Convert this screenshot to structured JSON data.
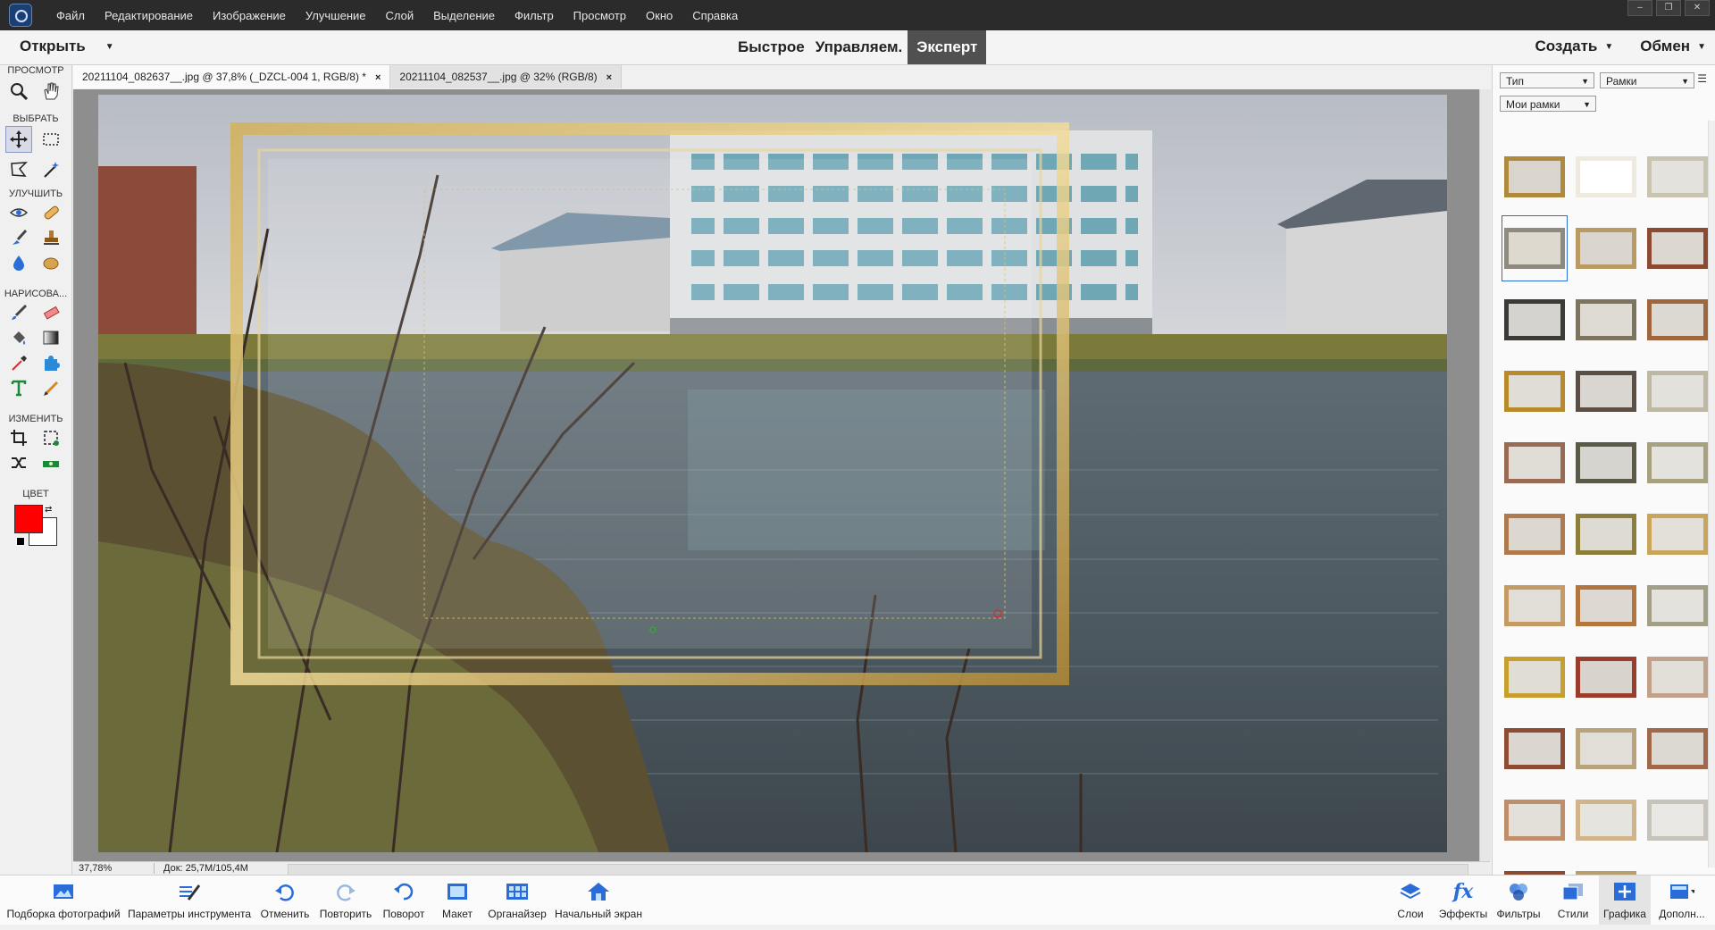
{
  "menubar": {
    "items": [
      "Файл",
      "Редактирование",
      "Изображение",
      "Улучшение",
      "Слой",
      "Выделение",
      "Фильтр",
      "Просмотр",
      "Окно",
      "Справка"
    ]
  },
  "modebar": {
    "open_label": "Открыть",
    "modes": [
      "Быстрое",
      "Управляем.",
      "Эксперт"
    ],
    "active_mode": "Эксперт",
    "create_label": "Создать",
    "share_label": "Обмен"
  },
  "toolbox": {
    "sections": [
      "ПРОСМОТР",
      "ВЫБРАТЬ",
      "УЛУЧШИТЬ",
      "НАРИСОВА...",
      "ИЗМЕНИТЬ",
      "ЦВЕТ"
    ],
    "foreground_color": "#ff0000",
    "background_color": "#ffffff"
  },
  "doc_tabs": [
    {
      "title": "20211104_082637__.jpg @ 37,8% (_DZCL-004 1, RGB/8) *",
      "close": "×"
    },
    {
      "title": "20211104_082537__.jpg @ 32% (RGB/8)",
      "close": "×"
    }
  ],
  "status": {
    "zoom": "37,78%",
    "doc": "Док: 25,7M/105,4M"
  },
  "panel": {
    "type_dropdown": "Тип",
    "category_dropdown": "Рамки",
    "set_dropdown": "Мои рамки",
    "frames": [
      {
        "outer": "#b08a3c",
        "inner": "#d9d5cc"
      },
      {
        "outer": "#efeae0",
        "inner": "#ffffff"
      },
      {
        "outer": "#c9c3b1",
        "inner": "#e4e2dc"
      },
      {
        "outer": "#8f8a7f",
        "inner": "#ddd9cf"
      },
      {
        "outer": "#b99a62",
        "inner": "#dad6cf"
      },
      {
        "outer": "#8c4a32",
        "inner": "#dcd8d0"
      },
      {
        "outer": "#3b3a36",
        "inner": "#d5d3cf"
      },
      {
        "outer": "#7c7460",
        "inner": "#dedbd3"
      },
      {
        "outer": "#a0673f",
        "inner": "#dcd9d3"
      },
      {
        "outer": "#b88a2a",
        "inner": "#e0ddd6"
      },
      {
        "outer": "#5a4e45",
        "inner": "#d9d6d1"
      },
      {
        "outer": "#bdb7a4",
        "inner": "#e2e1dc"
      },
      {
        "outer": "#9a6b54",
        "inner": "#e0dcd6"
      },
      {
        "outer": "#5b5a48",
        "inner": "#d6d4ce"
      },
      {
        "outer": "#a7a17f",
        "inner": "#e3e2dc"
      },
      {
        "outer": "#b07a4f",
        "inner": "#dcd8d0"
      },
      {
        "outer": "#8b7d3a",
        "inner": "#dedbd2"
      },
      {
        "outer": "#c8a55a",
        "inner": "#e2e0d9"
      },
      {
        "outer": "#c69a63",
        "inner": "#e1ded8"
      },
      {
        "outer": "#b4763f",
        "inner": "#ddd9d2"
      },
      {
        "outer": "#a29e88",
        "inner": "#e3e2dc"
      },
      {
        "outer": "#c79f2e",
        "inner": "#e0ddd5"
      },
      {
        "outer": "#9b3d2c",
        "inner": "#d8d4cd"
      },
      {
        "outer": "#c2a18a",
        "inner": "#e2dfd9"
      },
      {
        "outer": "#8e4c34",
        "inner": "#dbd7d0"
      },
      {
        "outer": "#b8a37c",
        "inner": "#e1ded7"
      },
      {
        "outer": "#a06a4a",
        "inner": "#dcd9d3"
      },
      {
        "outer": "#bf8f6c",
        "inner": "#e3e0da"
      },
      {
        "outer": "#d1b48a",
        "inner": "#e6e4de"
      },
      {
        "outer": "#c6c3bb",
        "inner": "#e8e7e3"
      },
      {
        "outer": "#8a4b33",
        "inner": "#dcd8d2"
      },
      {
        "outer": "#b99e72",
        "inner": "#e3e0da"
      }
    ]
  },
  "taskbar": {
    "left": [
      {
        "label": "Подборка фотографий",
        "icon": "photo-bin-icon"
      },
      {
        "label": "Параметры инструмента",
        "icon": "tool-options-icon"
      },
      {
        "label": "Отменить",
        "icon": "undo-icon"
      },
      {
        "label": "Повторить",
        "icon": "redo-icon"
      },
      {
        "label": "Поворот",
        "icon": "rotate-icon"
      },
      {
        "label": "Макет",
        "icon": "layout-icon"
      },
      {
        "label": "Органайзер",
        "icon": "organizer-icon"
      },
      {
        "label": "Начальный экран",
        "icon": "home-screen-icon"
      }
    ],
    "right": [
      {
        "label": "Слои",
        "icon": "layers-icon"
      },
      {
        "label": "Эффекты",
        "icon": "fx-icon"
      },
      {
        "label": "Фильтры",
        "icon": "filters-icon"
      },
      {
        "label": "Стили",
        "icon": "styles-icon"
      },
      {
        "label": "Графика",
        "icon": "graphics-icon"
      },
      {
        "label": "Дополн...",
        "icon": "more-icon"
      }
    ],
    "fx_text": "fx"
  }
}
